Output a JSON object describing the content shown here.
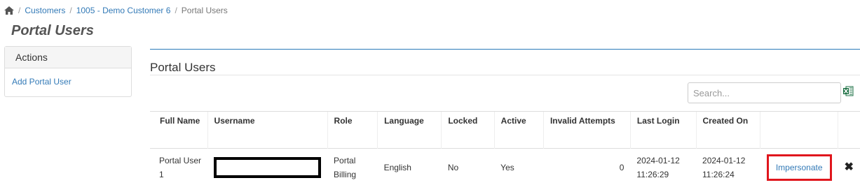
{
  "breadcrumb": {
    "home_icon": "home-icon",
    "separator": "/",
    "items": [
      "Customers",
      "1005 - Demo Customer 6"
    ],
    "current": "Portal Users"
  },
  "page": {
    "title": "Portal Users"
  },
  "actions": {
    "header": "Actions",
    "add_label": "Add Portal User"
  },
  "section": {
    "title": "Portal Users"
  },
  "search": {
    "placeholder": "Search...",
    "value": ""
  },
  "export_icon": "excel-icon",
  "table": {
    "headers": [
      "Full Name",
      "Username",
      "Role",
      "Language",
      "Locked",
      "Active",
      "Invalid Attempts",
      "Last Login",
      "Created On"
    ],
    "rows": [
      {
        "full_name": "Portal User 1",
        "username": "",
        "role": "Portal Billing",
        "language": "English",
        "locked": "No",
        "active": "Yes",
        "invalid_attempts": "0",
        "last_login": "2024-01-12 11:26:29",
        "created_on": "2024-01-12 11:26:24",
        "action_label": "Impersonate",
        "delete_icon": "close-icon"
      }
    ]
  },
  "colors": {
    "link": "#337ab7",
    "highlight": "#e0161d",
    "rule": "#2b7bb9"
  }
}
